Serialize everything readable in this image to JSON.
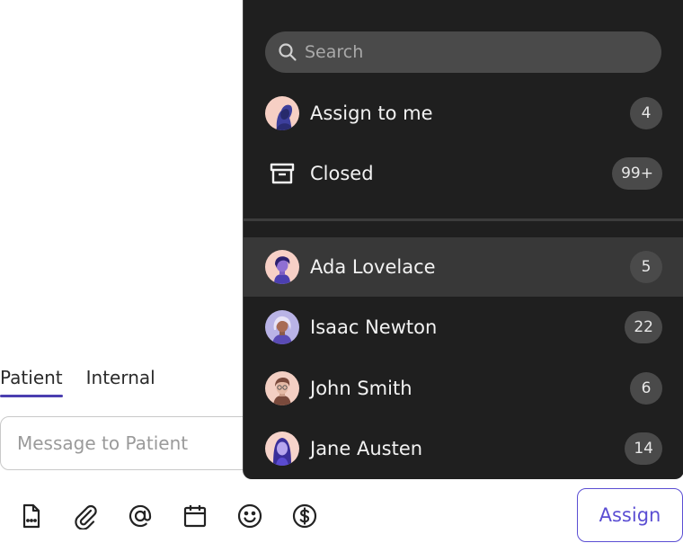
{
  "composer": {
    "tabs": [
      {
        "label": "Patient",
        "active": true
      },
      {
        "label": "Internal",
        "active": false
      }
    ],
    "message_placeholder": "Message to Patient",
    "toolbar_icons": [
      "document-icon",
      "paperclip-icon",
      "at-sign-icon",
      "calendar-icon",
      "emoji-icon",
      "dollar-icon"
    ],
    "assign_label": "Assign",
    "accent_color": "#5b4ed3"
  },
  "dropdown": {
    "search_placeholder": "Search",
    "quick_items": [
      {
        "label": "Assign to me",
        "count": "4",
        "icon": "avatar"
      },
      {
        "label": "Closed",
        "count": "99+",
        "icon": "archive-icon"
      }
    ],
    "users": [
      {
        "name": "Ada Lovelace",
        "count": "5",
        "highlighted": true
      },
      {
        "name": "Isaac Newton",
        "count": "22",
        "highlighted": false
      },
      {
        "name": "John Smith",
        "count": "6",
        "highlighted": false
      },
      {
        "name": "Jane Austen",
        "count": "14",
        "highlighted": false
      }
    ]
  }
}
